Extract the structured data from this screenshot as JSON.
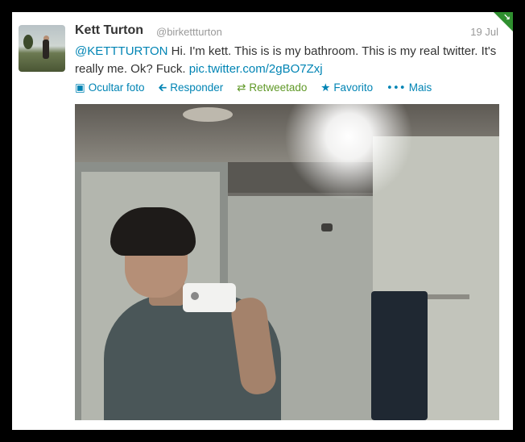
{
  "tweet": {
    "name": "Kett Turton",
    "handle": "@birkettturton",
    "date": "19 Jul",
    "mention": "@KETTTURTON",
    "body": " Hi. I'm kett. This is is my bathroom. This is my real twitter. It's really me. Ok? Fuck. ",
    "link": "pic.twitter.com/2gBO7Zxj"
  },
  "actions": {
    "hide_photo": "Ocultar foto",
    "reply": "Responder",
    "retweeted": "Retweetado",
    "favorite": "Favorito",
    "more": "Mais"
  },
  "colors": {
    "link": "#0084b4",
    "retweeted": "#609928",
    "name": "#333333",
    "muted": "#999999"
  },
  "icons": [
    "photo-icon",
    "reply-icon",
    "retweet-icon",
    "star-icon",
    "ellipsis-icon",
    "corner-badge-icon"
  ]
}
